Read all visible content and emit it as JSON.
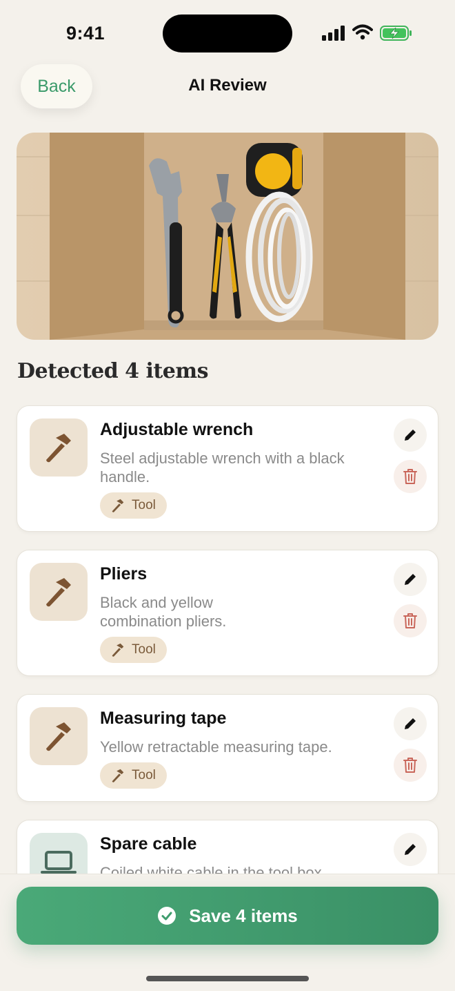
{
  "status": {
    "time": "9:41"
  },
  "header": {
    "back_label": "Back",
    "title": "AI Review"
  },
  "section": {
    "title": "Detected 4 items"
  },
  "items": [
    {
      "name": "Adjustable wrench",
      "desc": "Steel adjustable wrench with a black handle.",
      "tag": "Tool",
      "icon": "hammer-icon"
    },
    {
      "name": "Pliers",
      "desc": "Black and yellow combination pliers.",
      "tag": "Tool",
      "icon": "hammer-icon"
    },
    {
      "name": "Measuring tape",
      "desc": "Yellow retractable measuring tape.",
      "tag": "Tool",
      "icon": "hammer-icon"
    },
    {
      "name": "Spare cable",
      "desc": "Coiled white cable in the tool box.",
      "tag": "",
      "icon": "laptop-icon"
    }
  ],
  "footer": {
    "save_label": "Save 4 items"
  },
  "colors": {
    "accent": "#3b9a6a",
    "delete": "#c9665a",
    "tag_bg": "#f0e4d2",
    "tag_text": "#7a5a3a"
  }
}
